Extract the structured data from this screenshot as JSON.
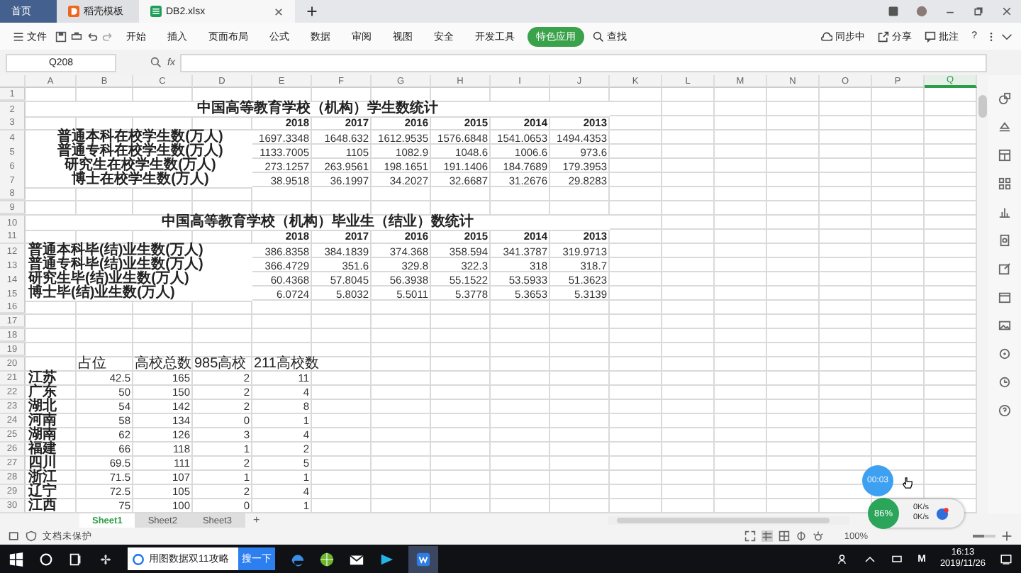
{
  "tabs": [
    {
      "label": "首页",
      "kind": "home",
      "selected": false
    },
    {
      "label": "稻壳模板",
      "kind": "template",
      "selected": false
    },
    {
      "label": "DB2.xlsx",
      "kind": "sheet",
      "selected": true
    }
  ],
  "ribbon": {
    "file_menu": "文件",
    "tabs": [
      {
        "label": "开始",
        "selected": false
      },
      {
        "label": "插入",
        "selected": false
      },
      {
        "label": "页面布局",
        "selected": false
      },
      {
        "label": "公式",
        "selected": false
      },
      {
        "label": "数据",
        "selected": false
      },
      {
        "label": "审阅",
        "selected": false
      },
      {
        "label": "视图",
        "selected": false
      },
      {
        "label": "安全",
        "selected": false
      },
      {
        "label": "开发工具",
        "selected": false
      },
      {
        "label": "特色应用",
        "selected": true
      }
    ],
    "search": "查找",
    "sync": "同步中",
    "share": "分享",
    "comment": "批注",
    "help": "?"
  },
  "formula_bar": {
    "name_box": "Q208",
    "fx": "fx"
  },
  "sheet": {
    "columns": [
      {
        "label": "A",
        "selected": false
      },
      {
        "label": "B",
        "selected": false
      },
      {
        "label": "C",
        "selected": false
      },
      {
        "label": "D",
        "selected": false
      },
      {
        "label": "E",
        "selected": false
      },
      {
        "label": "F",
        "selected": false
      },
      {
        "label": "G",
        "selected": false
      },
      {
        "label": "H",
        "selected": false
      },
      {
        "label": "I",
        "selected": false
      },
      {
        "label": "J",
        "selected": false
      },
      {
        "label": "K",
        "selected": false
      },
      {
        "label": "L",
        "selected": false
      },
      {
        "label": "M",
        "selected": false
      },
      {
        "label": "N",
        "selected": false
      },
      {
        "label": "O",
        "selected": false
      },
      {
        "label": "P",
        "selected": false
      },
      {
        "label": "Q",
        "selected": true
      }
    ],
    "rows": [
      {
        "number": "1",
        "kind": "empty"
      },
      {
        "number": "2",
        "kind": "title",
        "text": "中国高等教育学校（机构）学生数统计"
      },
      {
        "number": "3",
        "kind": "years",
        "values": [
          "2018",
          "2017",
          "2016",
          "2015",
          "2014",
          "2013"
        ]
      },
      {
        "number": "4",
        "kind": "stat",
        "label": "普通本科在校学生数(万人)",
        "values": [
          "1697.3348",
          "1648.632",
          "1612.9535",
          "1576.6848",
          "1541.0653",
          "1494.4353"
        ]
      },
      {
        "number": "5",
        "kind": "stat",
        "label": "普通专科在校学生数(万人)",
        "values": [
          "1133.7005",
          "1105",
          "1082.9",
          "1048.6",
          "1006.6",
          "973.6"
        ]
      },
      {
        "number": "6",
        "kind": "stat",
        "label": "研究生在校学生数(万人)",
        "values": [
          "273.1257",
          "263.9561",
          "198.1651",
          "191.1406",
          "184.7689",
          "179.3953"
        ]
      },
      {
        "number": "7",
        "kind": "stat",
        "label": "博士在校学生数(万人)",
        "values": [
          "38.9518",
          "36.1997",
          "34.2027",
          "32.6687",
          "31.2676",
          "29.8283"
        ]
      },
      {
        "number": "8",
        "kind": "empty"
      },
      {
        "number": "9",
        "kind": "empty"
      },
      {
        "number": "10",
        "kind": "title",
        "text": "中国高等教育学校（机构）毕业生（结业）数统计"
      },
      {
        "number": "11",
        "kind": "years",
        "values": [
          "2018",
          "2017",
          "2016",
          "2015",
          "2014",
          "2013"
        ]
      },
      {
        "number": "12",
        "kind": "grad",
        "label": "普通本科毕(结)业生数(万人)",
        "values": [
          "386.8358",
          "384.1839",
          "374.368",
          "358.594",
          "341.3787",
          "319.9713"
        ]
      },
      {
        "number": "13",
        "kind": "grad",
        "label": "普通专科毕(结)业生数(万人)",
        "values": [
          "366.4729",
          "351.6",
          "329.8",
          "322.3",
          "318",
          "318.7"
        ]
      },
      {
        "number": "14",
        "kind": "grad",
        "label": "研究生毕(结)业生数(万人)",
        "values": [
          "60.4368",
          "57.8045",
          "56.3938",
          "55.1522",
          "53.5933",
          "51.3623"
        ]
      },
      {
        "number": "15",
        "kind": "grad",
        "label": "博士毕(结)业生数(万人)",
        "values": [
          "6.0724",
          "5.8032",
          "5.5011",
          "5.3778",
          "5.3653",
          "5.3139"
        ]
      },
      {
        "number": "16",
        "kind": "empty"
      },
      {
        "number": "17",
        "kind": "empty"
      },
      {
        "number": "18",
        "kind": "empty"
      },
      {
        "number": "19",
        "kind": "empty"
      },
      {
        "number": "20",
        "kind": "uni_header",
        "labels": [
          "占位",
          "高校总数",
          "985高校",
          "211高校数"
        ]
      },
      {
        "number": "21",
        "kind": "province",
        "name": "江苏",
        "values": [
          "42.5",
          "165",
          "2",
          "11"
        ]
      },
      {
        "number": "22",
        "kind": "province",
        "name": "广东",
        "values": [
          "50",
          "150",
          "2",
          "4"
        ]
      },
      {
        "number": "23",
        "kind": "province",
        "name": "湖北",
        "values": [
          "54",
          "142",
          "2",
          "8"
        ]
      },
      {
        "number": "24",
        "kind": "province",
        "name": "河南",
        "values": [
          "58",
          "134",
          "0",
          "1"
        ]
      },
      {
        "number": "25",
        "kind": "province",
        "name": "湖南",
        "values": [
          "62",
          "126",
          "3",
          "4"
        ]
      },
      {
        "number": "26",
        "kind": "province",
        "name": "福建",
        "values": [
          "66",
          "118",
          "1",
          "2"
        ]
      },
      {
        "number": "27",
        "kind": "province",
        "name": "四川",
        "values": [
          "69.5",
          "111",
          "2",
          "5"
        ]
      },
      {
        "number": "28",
        "kind": "province",
        "name": "浙江",
        "values": [
          "71.5",
          "107",
          "1",
          "1"
        ]
      },
      {
        "number": "29",
        "kind": "province",
        "name": "辽宁",
        "values": [
          "72.5",
          "105",
          "2",
          "4"
        ]
      },
      {
        "number": "30",
        "kind": "province",
        "name": "江西",
        "values": [
          "75",
          "100",
          "0",
          "1"
        ]
      }
    ]
  },
  "sheet_tabs": [
    {
      "label": "Sheet1",
      "selected": true
    },
    {
      "label": "Sheet2",
      "selected": false
    },
    {
      "label": "Sheet3",
      "selected": false
    }
  ],
  "add_sheet": "+",
  "status_bar": {
    "protection": "文档未保护",
    "zoom": "100%",
    "zoom_slider": {
      "level": 0.5
    }
  },
  "overlay": {
    "timer": "00:03",
    "battery": "86%",
    "upload": "0K/s",
    "download": "0K/s"
  },
  "taskbar": {
    "search_text": "用图数据双11攻略",
    "search_button": "搜一下",
    "ime": "M",
    "time": "16:13",
    "date": "2019/11/26"
  }
}
